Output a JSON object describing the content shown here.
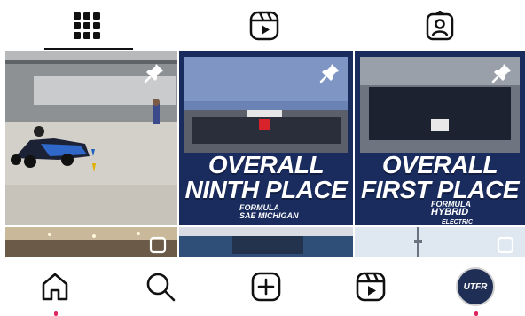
{
  "profile_tabs": {
    "posts": {
      "icon": "grid-icon",
      "active": true
    },
    "reels": {
      "icon": "reels-icon",
      "active": false
    },
    "tagged": {
      "icon": "tagged-icon",
      "active": false
    }
  },
  "posts": [
    {
      "pinned": true,
      "image": "race-car-on-track-photo"
    },
    {
      "pinned": true,
      "headline_line1": "OVERALL",
      "headline_line2": "NINTH PLACE",
      "badge_line1": "FORMULA",
      "badge_line2": "SAE MICHIGAN"
    },
    {
      "pinned": true,
      "headline_line1": "OVERALL",
      "headline_line2": "FIRST PLACE",
      "badge_line1": "FORMULA",
      "badge_line2": "HYBRID",
      "badge_line3": "ELECTRIC"
    },
    {
      "multi": true,
      "image": "hall-ceiling-photo"
    },
    {
      "multi": false,
      "image": "venue-photo"
    },
    {
      "multi": true,
      "image": "city-skyline-photo"
    }
  ],
  "bottom_nav": {
    "items": [
      "home-icon",
      "search-icon",
      "create-icon",
      "reels-icon",
      "profile-avatar"
    ],
    "avatar_text": "UTFR",
    "notification_color": "#e0245e"
  },
  "colors": {
    "navy_bg": "#1a2b5e",
    "text": "#111111"
  }
}
